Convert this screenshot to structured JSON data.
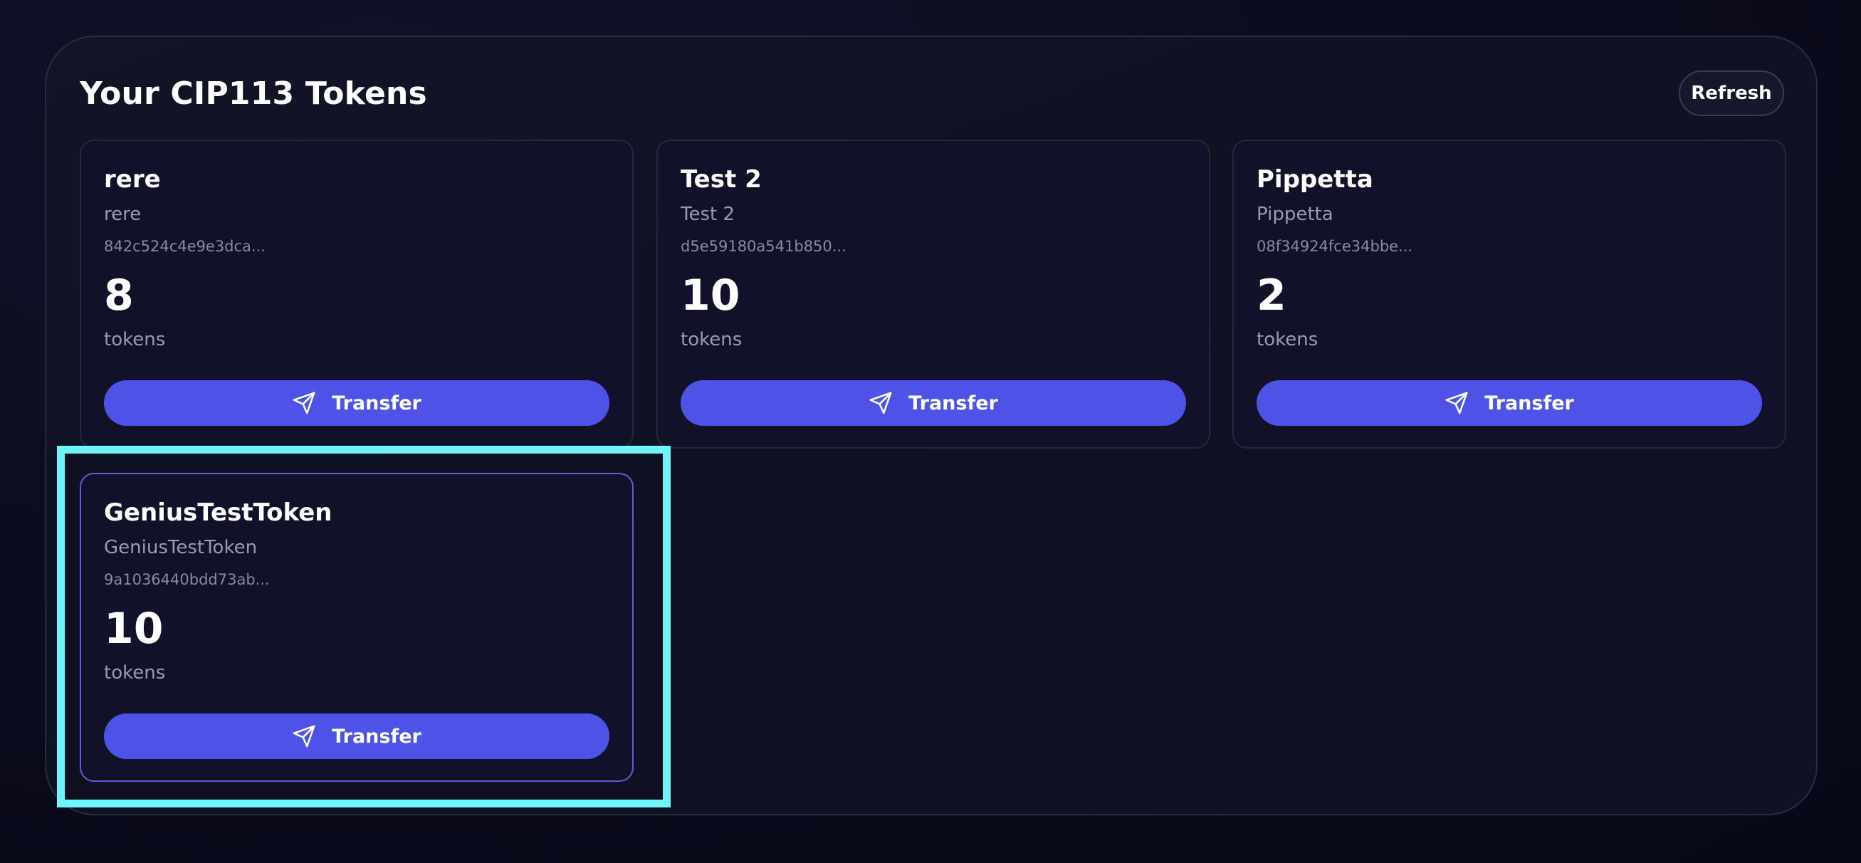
{
  "panel": {
    "title": "Your CIP113 Tokens",
    "refresh_label": "Refresh"
  },
  "tokens": [
    {
      "name": "rere",
      "symbol": "rere",
      "id": "842c524c4e9e3dca...",
      "amount": "8",
      "unit": "tokens",
      "transfer_label": "Transfer"
    },
    {
      "name": "Test 2",
      "symbol": "Test 2",
      "id": "d5e59180a541b850...",
      "amount": "10",
      "unit": "tokens",
      "transfer_label": "Transfer"
    },
    {
      "name": "Pippetta",
      "symbol": "Pippetta",
      "id": "08f34924fce34bbe...",
      "amount": "2",
      "unit": "tokens",
      "transfer_label": "Transfer"
    },
    {
      "name": "GeniusTestToken",
      "symbol": "GeniusTestToken",
      "id": "9a1036440bdd73ab...",
      "amount": "10",
      "unit": "tokens",
      "transfer_label": "Transfer"
    }
  ],
  "icons": {
    "transfer": "send-icon"
  },
  "colors": {
    "background": "#0a0b1c",
    "panel": "#121427",
    "card": "#11122a",
    "accent": "#4f52e6",
    "highlight": "#6ff5f8"
  }
}
